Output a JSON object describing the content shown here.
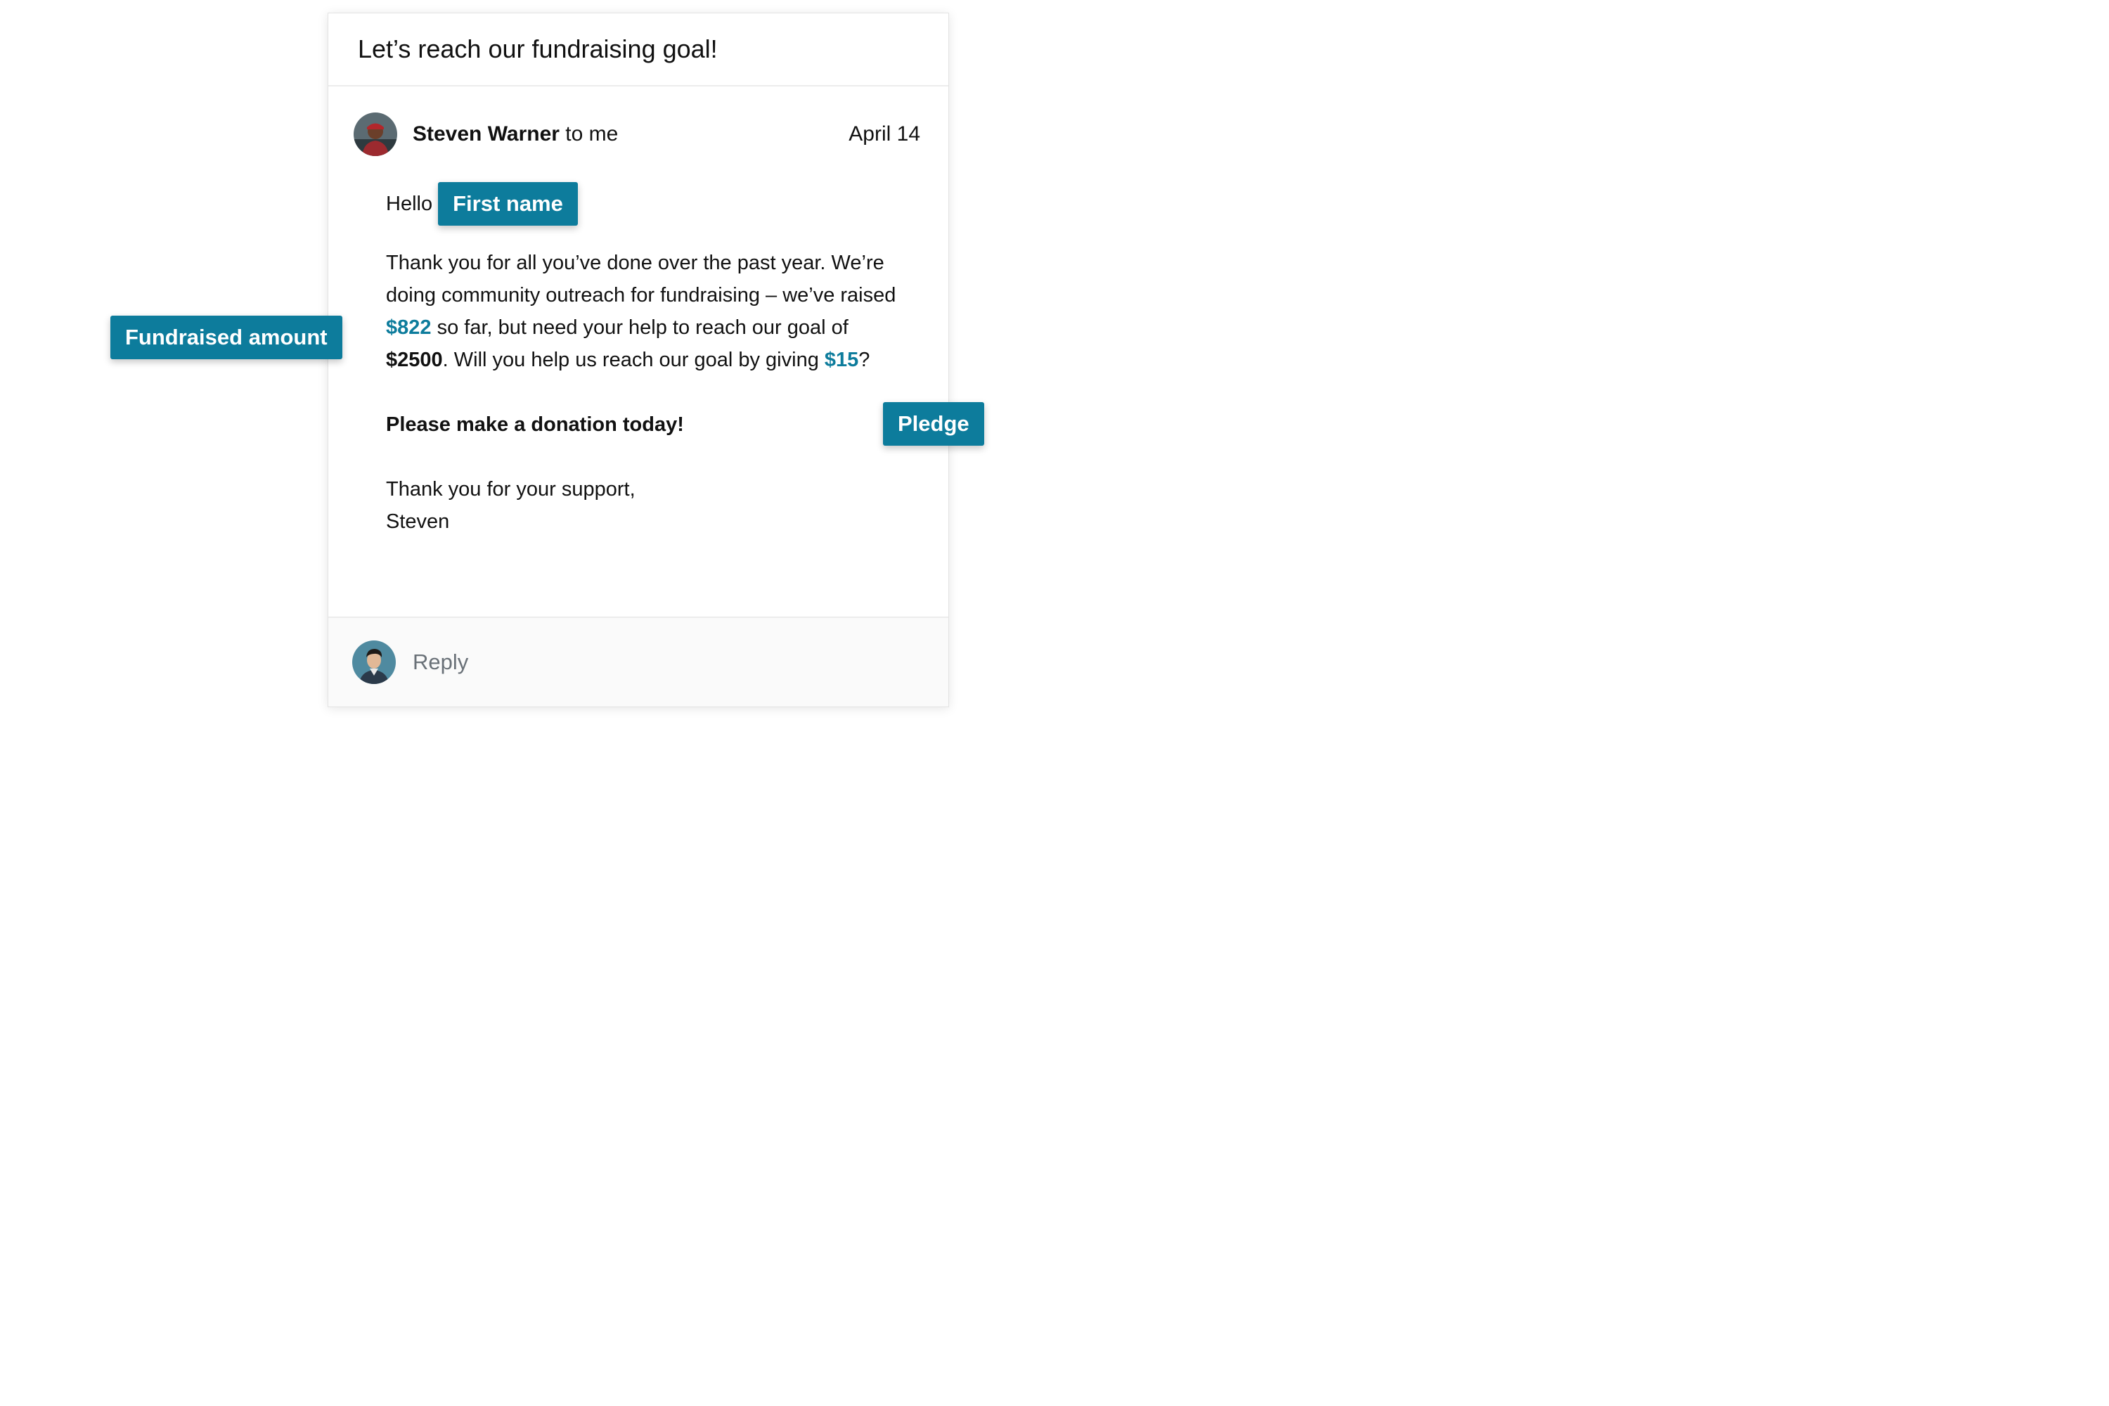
{
  "email": {
    "subject": "Let’s reach our fundraising goal!",
    "sender_name": "Steven Warner",
    "sender_suffix": " to me",
    "date": "April 14",
    "greeting": "Hello",
    "body": {
      "line1": "Thank you for all you’ve done over the past year. We’re doing community outreach for fundraising – we’ve raised ",
      "raised_amount": "$822",
      "line2": " so far, but need your help to reach our goal of ",
      "goal_amount": "$2500",
      "line3": ". Will you help us reach our goal by giving ",
      "pledge_amount": "$15",
      "line4": "?"
    },
    "cta": "Please make a donation today!",
    "closing": "Thank you for your support,",
    "signature": "Steven"
  },
  "footer": {
    "reply_placeholder": "Reply"
  },
  "tags": {
    "first_name": "First name",
    "fundraised_amount": "Fundraised amount",
    "pledge": "Pledge"
  },
  "colors": {
    "accent": "#0d7c9c"
  }
}
